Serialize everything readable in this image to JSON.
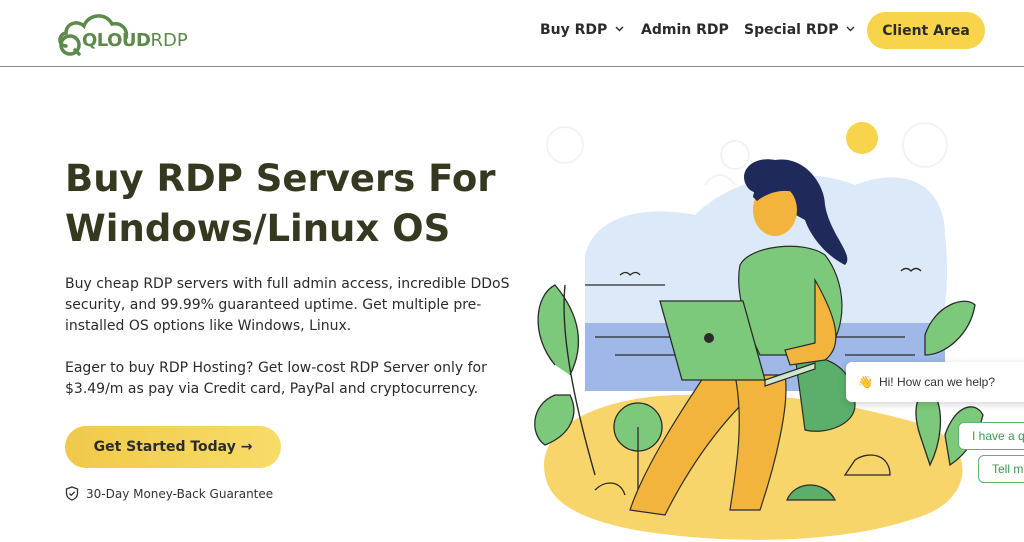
{
  "header": {
    "logo": {
      "part1": "QLOUD",
      "part2": "RDP"
    },
    "nav": [
      {
        "label": "Buy RDP",
        "has_dropdown": true
      },
      {
        "label": "Admin RDP",
        "has_dropdown": false
      },
      {
        "label": "Special RDP",
        "has_dropdown": true
      }
    ],
    "client_area": "Client Area"
  },
  "hero": {
    "title": "Buy RDP Servers For Windows/Linux OS",
    "paragraph1": "Buy cheap RDP servers with full admin access, incredible DDoS security, and 99.99% guaranteed uptime. Get multiple pre-installed OS options like Windows, Linux.",
    "paragraph2": "Eager to buy RDP Hosting? Get low-cost RDP Server only for $3.49/m as pay via Credit card, PayPal and cryptocurrency.",
    "cta": "Get Started Today →",
    "guarantee": "30-Day Money-Back Guarantee"
  },
  "chat": {
    "greeting": "Hi! How can we help?",
    "options": [
      "I have a qu",
      "Tell me"
    ]
  },
  "colors": {
    "accent_yellow": "#f7d44c",
    "brand_green": "#5b8a4a",
    "title_dark": "#36391f",
    "chat_green": "#5bb56a"
  },
  "icons": [
    "chevron-down-icon",
    "shield-check-icon",
    "waving-hand-icon",
    "arrow-right-icon"
  ]
}
